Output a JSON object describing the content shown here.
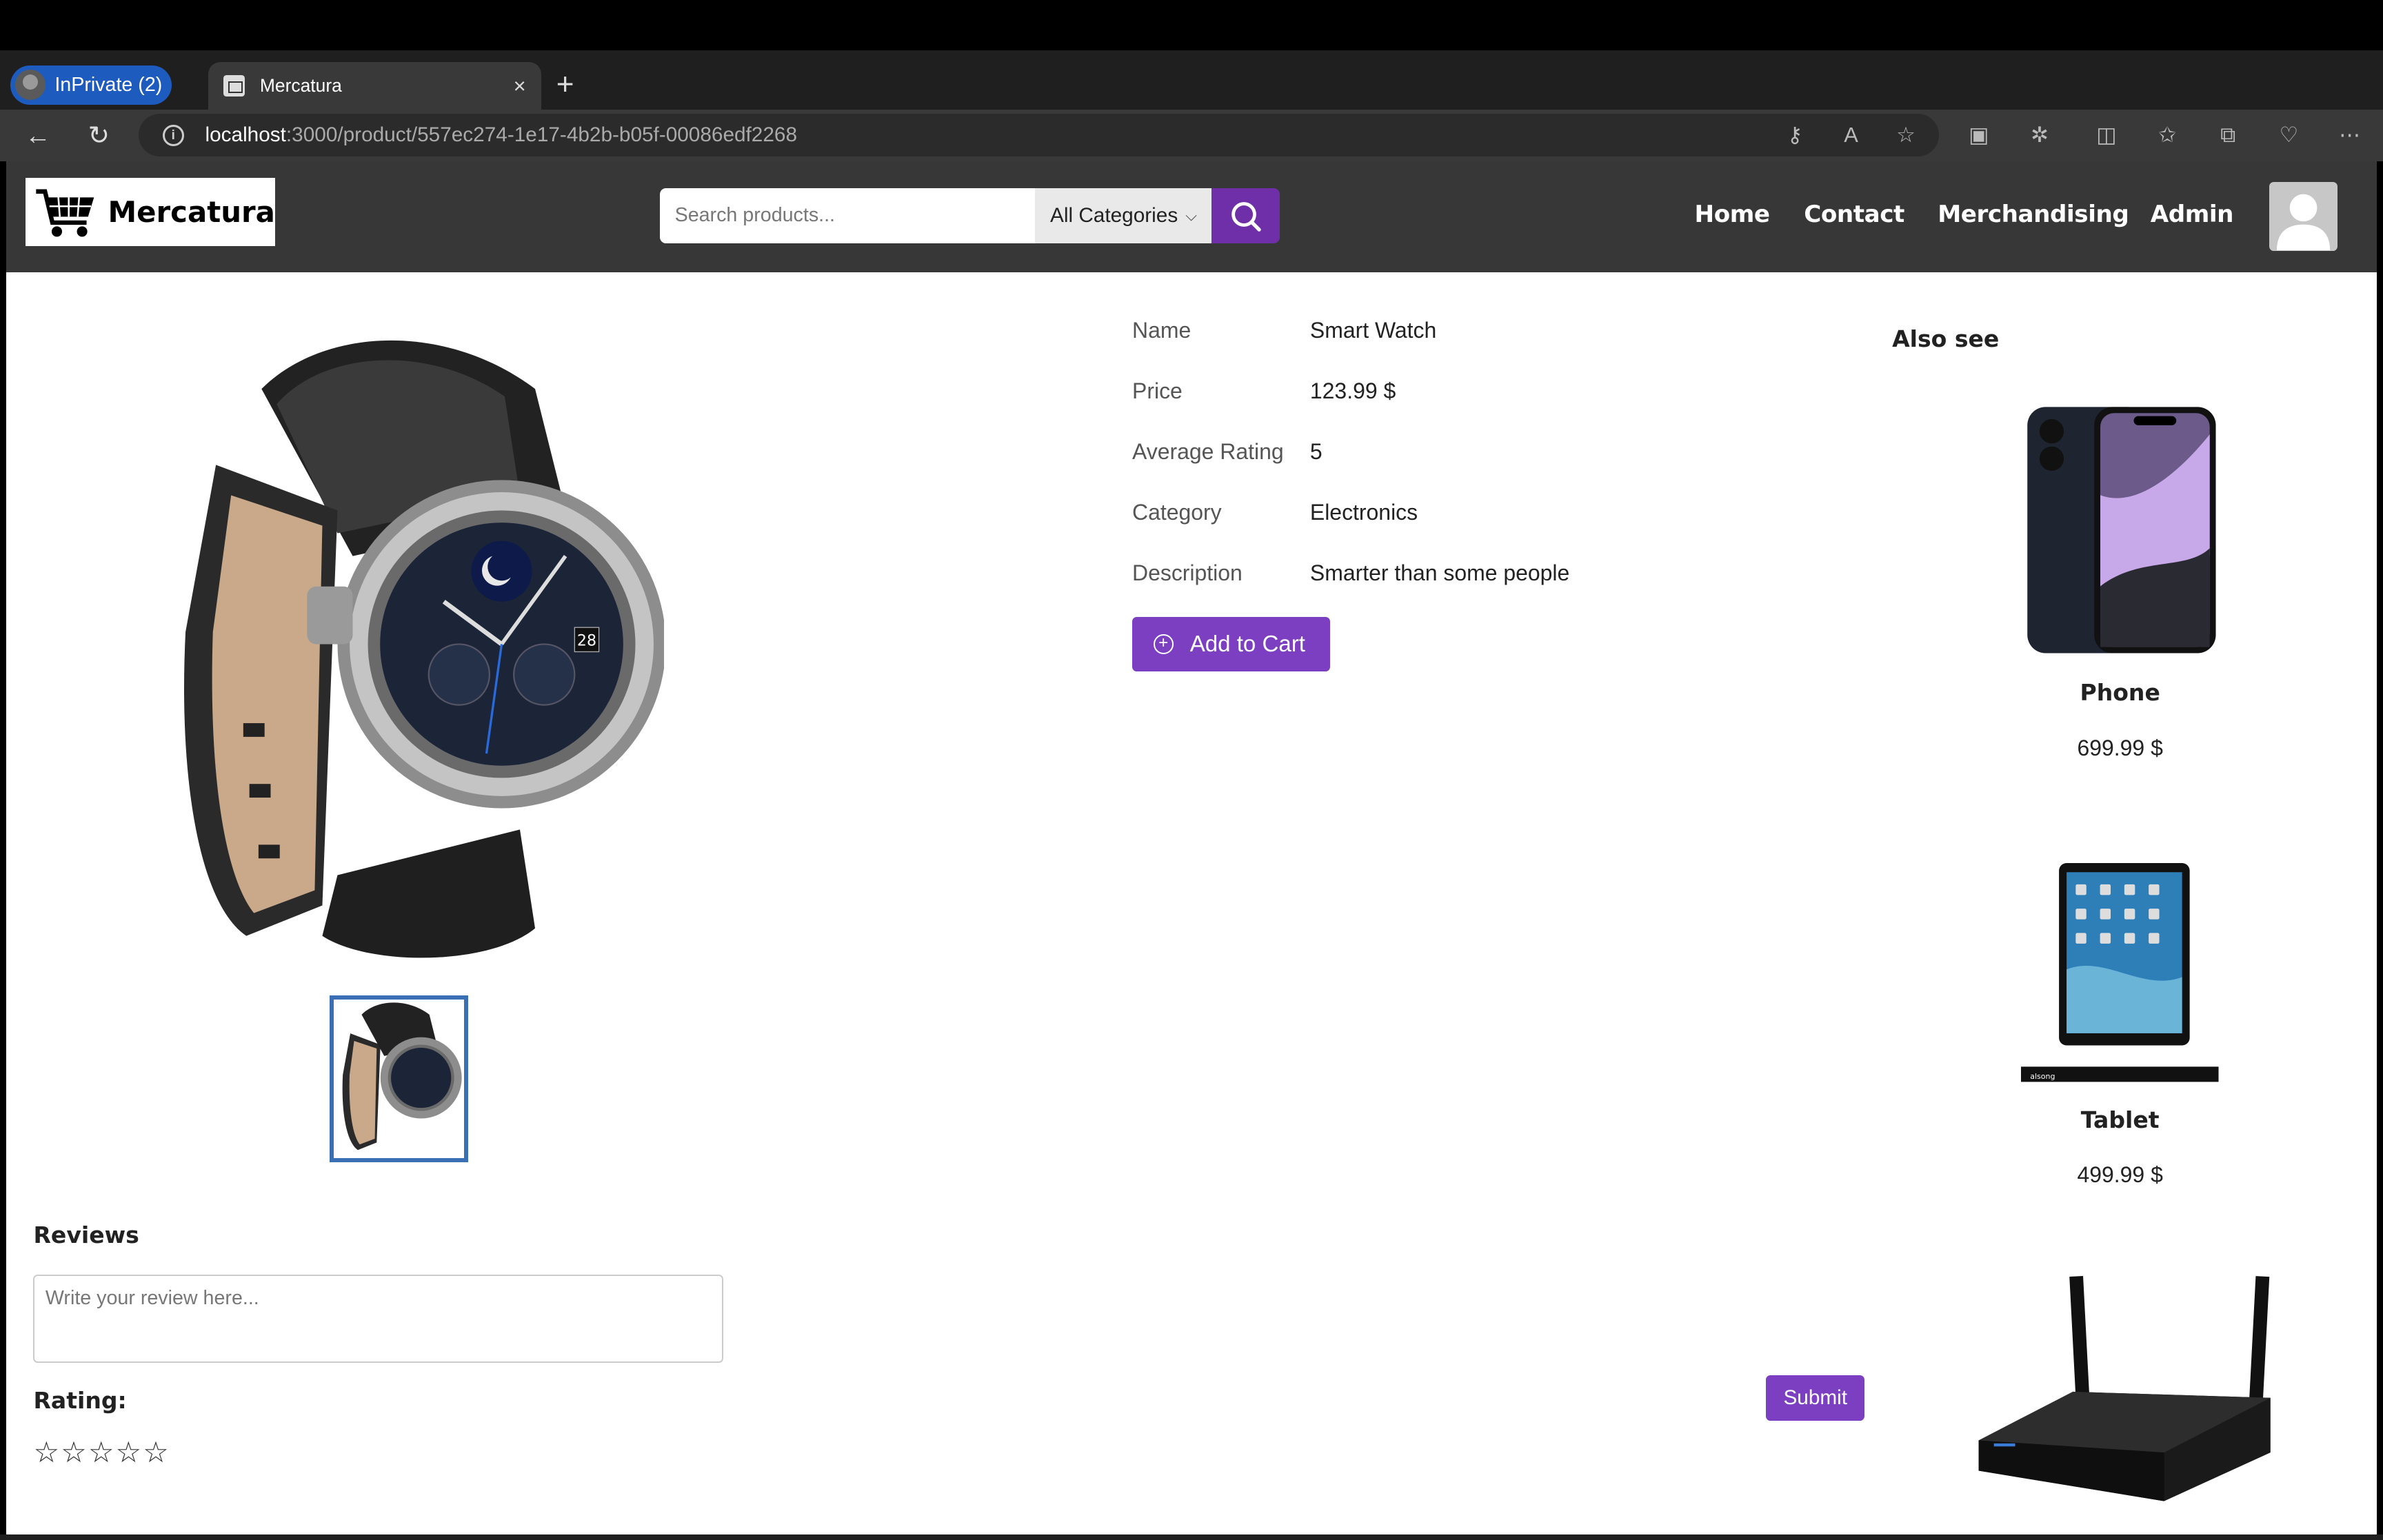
{
  "browser": {
    "inprivate_label": "InPrivate (2)",
    "tab_title": "Mercatura",
    "tab_close": "×",
    "new_tab": "+",
    "url_host": "localhost",
    "url_path": ":3000/product/557ec274-1e17-4b2b-b05f-00086edf2268"
  },
  "header": {
    "logo_text": "Mercatura",
    "search_placeholder": "Search products...",
    "category_selected": "All Categories",
    "nav": [
      "Home",
      "Contact",
      "Merchandising",
      "Admin"
    ]
  },
  "product": {
    "fields": [
      {
        "key": "Name",
        "value": "Smart Watch"
      },
      {
        "key": "Price",
        "value": "123.99 $"
      },
      {
        "key": "Average Rating",
        "value": "5"
      },
      {
        "key": "Category",
        "value": "Electronics"
      },
      {
        "key": "Description",
        "value": "Smarter than some people"
      }
    ],
    "add_to_cart_label": "Add to Cart",
    "watch_date": "28"
  },
  "also_see": {
    "title": "Also see",
    "items": [
      {
        "name": "Phone",
        "price": "699.99 $"
      },
      {
        "name": "Tablet",
        "price": "499.99 $"
      }
    ],
    "tablet_brand": "alsong"
  },
  "reviews": {
    "title": "Reviews",
    "placeholder": "Write your review here...",
    "rating_label": "Rating:",
    "star_glyph": "☆",
    "submit_label": "Submit"
  },
  "colors": {
    "accent": "#7c3fc2",
    "header_bg": "#373737",
    "thumb_border": "#3b6fb5"
  }
}
